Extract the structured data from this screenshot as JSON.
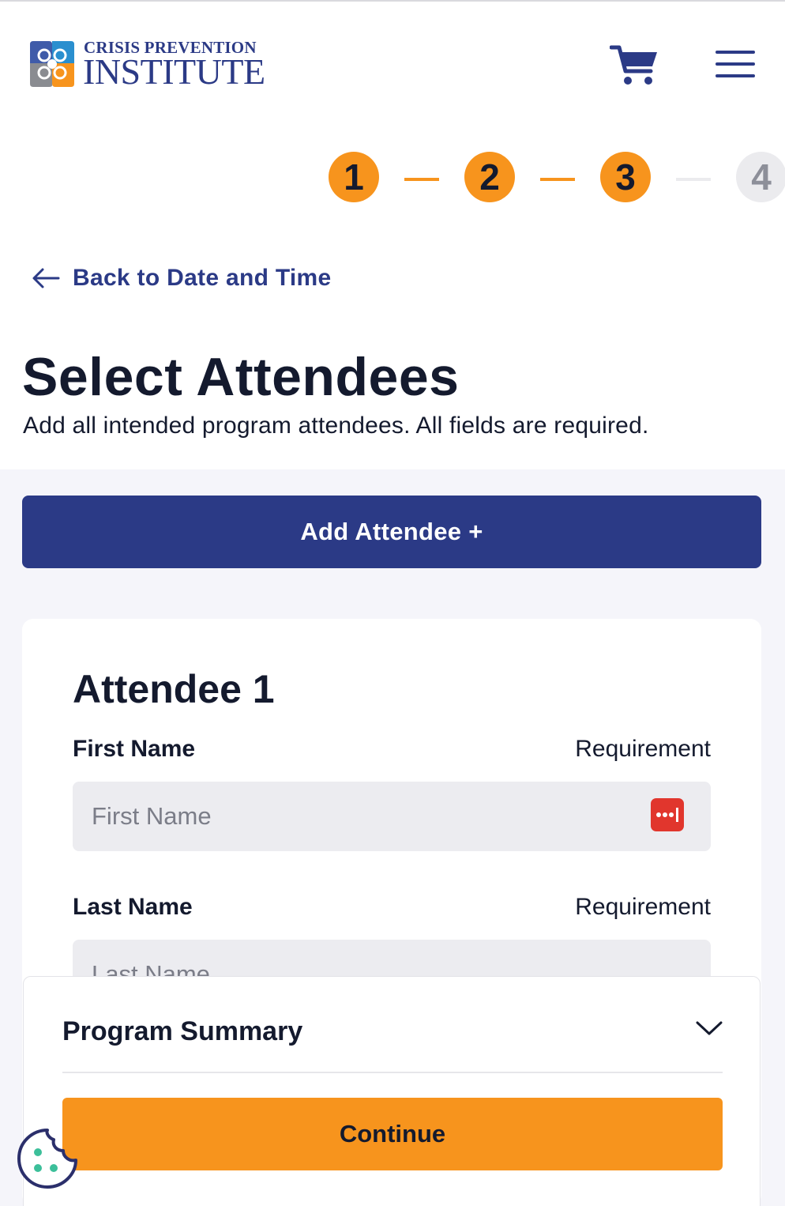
{
  "header": {
    "logo_line1": "CRISIS PREVENTION",
    "logo_line2": "INSTITUTE",
    "cart_icon": "shopping-cart-icon",
    "menu_icon": "hamburger-menu-icon",
    "brand_color": "#2b3a86",
    "accent_color": "#f7941d"
  },
  "stepper": {
    "steps": [
      {
        "label": "1",
        "state": "complete"
      },
      {
        "label": "2",
        "state": "complete"
      },
      {
        "label": "3",
        "state": "current"
      },
      {
        "label": "4",
        "state": "upcoming"
      }
    ]
  },
  "back_link": {
    "icon": "arrow-left-icon",
    "label": "Back to Date and Time"
  },
  "page": {
    "title": "Select Attendees",
    "subtitle": "Add all intended program attendees. All fields are required."
  },
  "add_attendee": {
    "label": "Add Attendee +"
  },
  "attendee_card": {
    "title": "Attendee 1",
    "fields": [
      {
        "label": "First Name",
        "requirement": "Requirement",
        "value": "",
        "placeholder": "First Name",
        "icon": "password-manager-icon"
      },
      {
        "label": "Last Name",
        "requirement": "Requirement",
        "value": "",
        "placeholder": "Last Name"
      }
    ]
  },
  "summary": {
    "title": "Program Summary",
    "toggle_icon": "chevron-down-icon",
    "continue_label": "Continue"
  },
  "cookie_button": {
    "icon": "cookie-icon"
  }
}
